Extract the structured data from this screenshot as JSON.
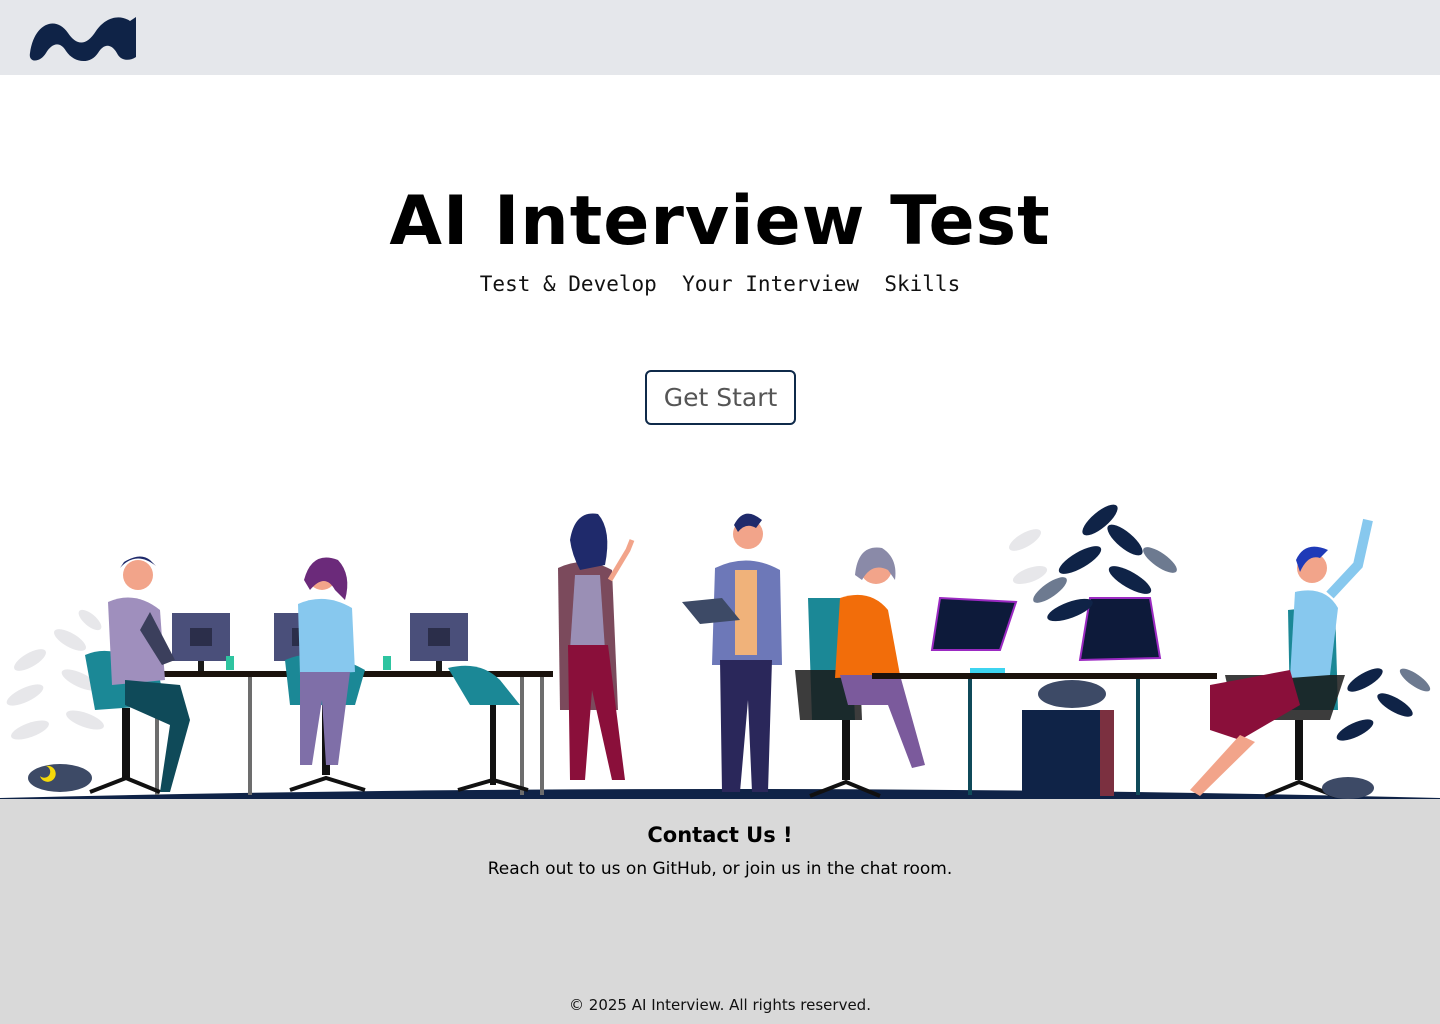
{
  "header": {
    "logo_icon": "wave-logo-icon"
  },
  "hero": {
    "title": "AI Interview Test",
    "subtitle": "Test & Develop  Your Interview  Skills",
    "cta_label": "Get Start"
  },
  "illustration": {
    "icon": "office-team-illustration"
  },
  "footer": {
    "contact_title": "Contact Us !",
    "contact_text": "Reach out to us on GitHub, or join us in the chat room.",
    "copyright_symbol": "©",
    "copyright_year": "2025",
    "copyright_text": "AI Interview. All rights reserved."
  },
  "colors": {
    "header_bg": "#e5e7eb",
    "logo": "#0f2347",
    "footer_bg": "#d9d9d9",
    "button_border": "#0f2a4a"
  }
}
